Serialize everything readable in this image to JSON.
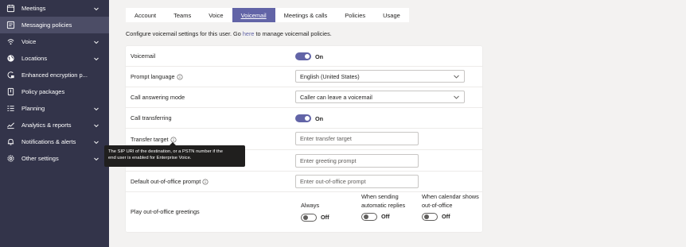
{
  "sidebar": {
    "items": [
      {
        "label": "Meetings",
        "icon": "calendar-icon",
        "chevron": true,
        "active": false
      },
      {
        "label": "Messaging policies",
        "icon": "message-icon",
        "chevron": false,
        "active": true
      },
      {
        "label": "Voice",
        "icon": "voice-icon",
        "chevron": true,
        "active": false
      },
      {
        "label": "Locations",
        "icon": "globe-icon",
        "chevron": true,
        "active": false
      },
      {
        "label": "Enhanced encryption p...",
        "icon": "encryption-icon",
        "chevron": false,
        "active": false
      },
      {
        "label": "Policy packages",
        "icon": "package-icon",
        "chevron": false,
        "active": false
      },
      {
        "label": "Planning",
        "icon": "planning-icon",
        "chevron": true,
        "active": false
      },
      {
        "label": "Analytics & reports",
        "icon": "analytics-icon",
        "chevron": true,
        "active": false
      },
      {
        "label": "Notifications & alerts",
        "icon": "bell-icon",
        "chevron": true,
        "active": false
      },
      {
        "label": "Other settings",
        "icon": "gear-icon",
        "chevron": true,
        "active": false
      }
    ]
  },
  "tabs": [
    {
      "label": "Account",
      "active": false
    },
    {
      "label": "Teams",
      "active": false
    },
    {
      "label": "Voice",
      "active": false
    },
    {
      "label": "Voicemail",
      "active": true
    },
    {
      "label": "Meetings & calls",
      "active": false
    },
    {
      "label": "Policies",
      "active": false
    },
    {
      "label": "Usage",
      "active": false
    }
  ],
  "description": {
    "prefix": "Configure voicemail settings for this user. Go ",
    "link": "here",
    "suffix": " to manage voicemail policies."
  },
  "settings": {
    "voicemail": {
      "label": "Voicemail",
      "toggle": "On",
      "enabled": true
    },
    "prompt_language": {
      "label": "Prompt language",
      "value": "English (United States)"
    },
    "call_answering_mode": {
      "label": "Call answering mode",
      "value": "Caller can leave a voicemail"
    },
    "call_transferring": {
      "label": "Call transferring",
      "toggle": "On",
      "enabled": true
    },
    "transfer_target": {
      "label": "Transfer target",
      "placeholder": "Enter transfer target"
    },
    "greeting_prompt": {
      "label": "",
      "placeholder": "Enter greeting prompt"
    },
    "default_ooo_prompt": {
      "label": "Default out-of-office prompt",
      "placeholder": "Enter out-of-office prompt"
    },
    "play_ooo_greetings": {
      "label": "Play out-of-office greetings",
      "options": [
        {
          "label_line1": "Always",
          "label_line2": "",
          "toggle": "Off",
          "enabled": false
        },
        {
          "label_line1": "When sending",
          "label_line2": "automatic replies",
          "toggle": "Off",
          "enabled": false
        },
        {
          "label_line1": "When calendar shows",
          "label_line2": "out-of-office",
          "toggle": "Off",
          "enabled": false
        }
      ]
    }
  },
  "tooltip": {
    "line1": "The SIP URI of the destination, or a PSTN number if the",
    "line2": "end user is enabled for Enterprise Voice."
  },
  "colors": {
    "sidebar_bg": "#33344a",
    "accent": "#6264a7",
    "page_bg": "#f3f2f1"
  }
}
